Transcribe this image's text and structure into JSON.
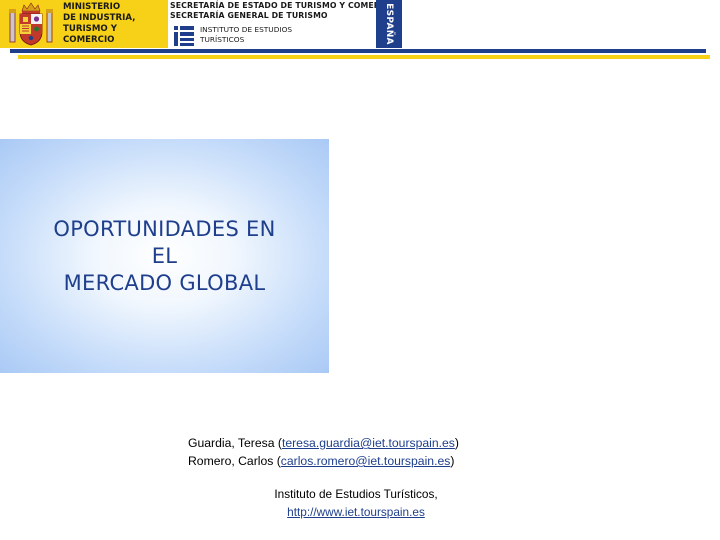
{
  "header": {
    "ministry_lines": [
      "MINISTERIO",
      "DE INDUSTRIA,",
      "TURISMO Y",
      "COMERCIO"
    ],
    "secretaria_estado": "SECRETARÍA DE ESTADO DE TURISMO Y COMERCIO",
    "secretaria_general": "SECRETARÍA GENERAL DE TURISMO",
    "institute_lines": [
      "INSTITUTO DE ESTUDIOS",
      "TURÍSTICOS"
    ],
    "country": "ESPAÑA",
    "colors": {
      "yellow": "#f7d117",
      "blue": "#1f3f8c"
    }
  },
  "title": {
    "line1": "OPORTUNIDADES EN",
    "line2": "EL",
    "line3": "MERCADO GLOBAL"
  },
  "authors": [
    {
      "name": "Guardia, Teresa",
      "email": "teresa.guardia@iet.tourspain.es"
    },
    {
      "name": "Romero, Carlos",
      "email": "carlos.romero@iet.tourspain.es"
    }
  ],
  "institution": {
    "name": "Instituto de Estudios Turísticos,",
    "url": "http://www.iet.tourspain.es"
  }
}
